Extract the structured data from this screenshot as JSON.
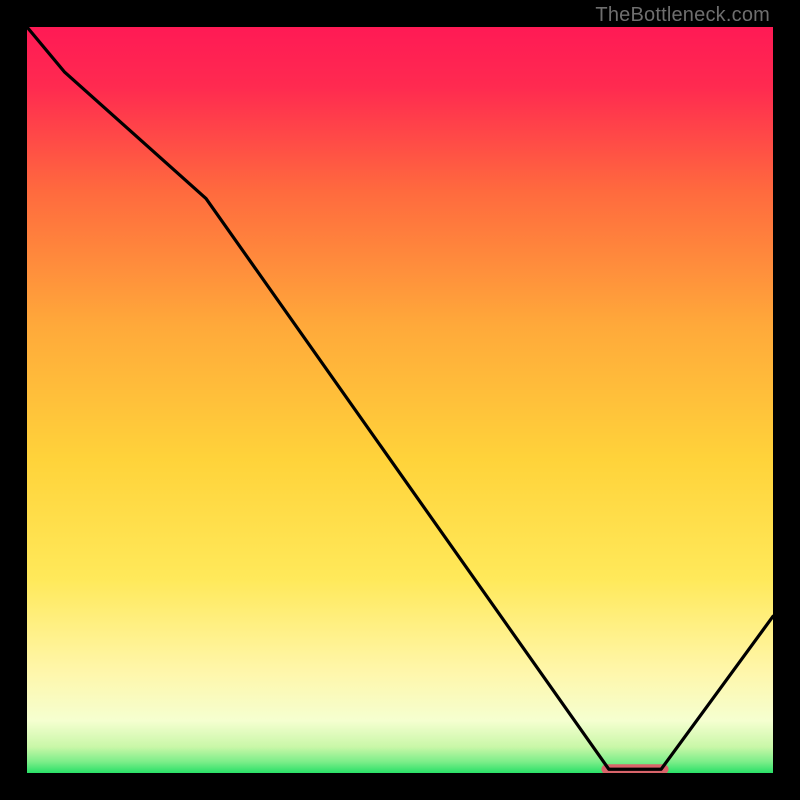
{
  "attribution": "TheBottleneck.com",
  "colors": {
    "gradient_top": "#ff1a55",
    "gradient_mid_upper": "#ff7a3c",
    "gradient_mid": "#ffd23a",
    "gradient_mid_lower": "#fff59a",
    "gradient_bottom": "#2ee36b",
    "curve": "#000000",
    "marker": "#d9646a",
    "frame": "#000000"
  },
  "chart_data": {
    "type": "line",
    "title": "",
    "xlabel": "",
    "ylabel": "",
    "xlim": [
      0,
      100
    ],
    "ylim": [
      0,
      100
    ],
    "x": [
      0,
      5,
      24,
      78,
      85,
      100
    ],
    "values": [
      100,
      94,
      77,
      0.5,
      0.5,
      21
    ],
    "marker_segment": {
      "x_start": 77,
      "x_end": 86,
      "y": 0.5
    },
    "notes": "Vertical gradient background from red (top) through orange/yellow to green (bottom band). Black V-shaped curve with its minimum near x≈78–85 touching the green band; a short salmon-red horizontal marker sits at the trough."
  }
}
